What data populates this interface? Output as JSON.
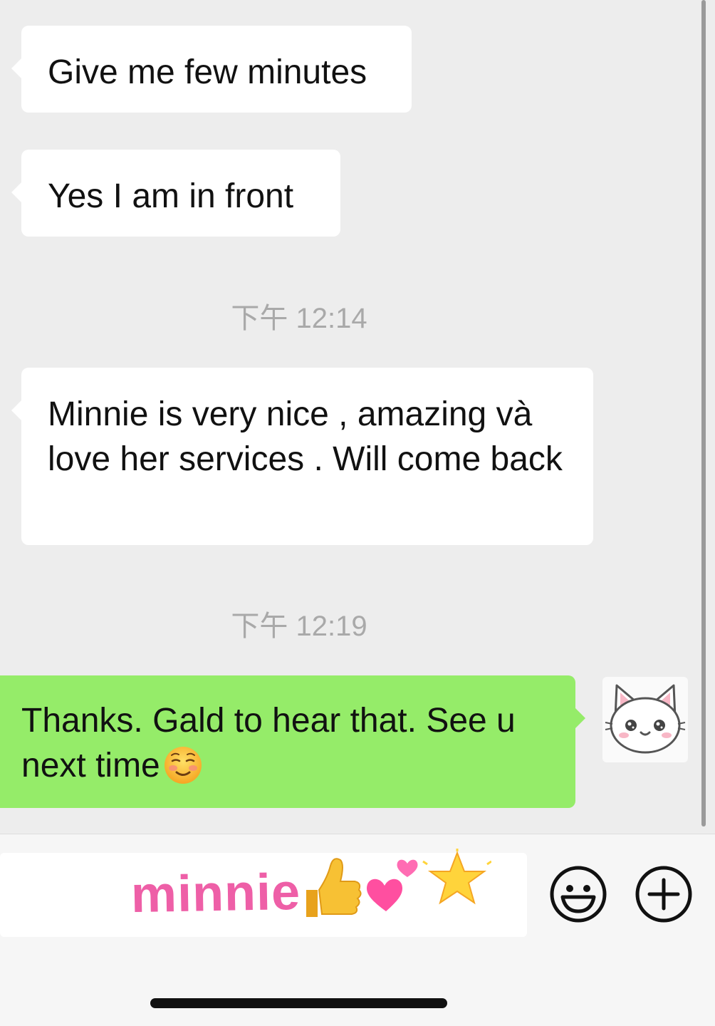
{
  "messages": [
    {
      "text": "Give me few minutes"
    },
    {
      "text": "Yes I am in front"
    },
    {
      "text": "Minnie is very nice , amazing và love her services . Will come back"
    },
    {
      "text": "Thanks. Gald to hear that. See u next time"
    }
  ],
  "timestamps": [
    "下午 12:14",
    "下午 12:19"
  ],
  "avatar": {
    "icon": "cat-icon"
  },
  "input": {
    "sticker_text": "minnie",
    "sticker_icons": [
      "thumbs-up-icon",
      "two-hearts-icon",
      "star-icon"
    ]
  },
  "toolbar": {
    "emoji_icon": "smiley-face-icon",
    "plus_icon": "plus-circle-icon"
  },
  "colors": {
    "background": "#ededed",
    "received_bubble": "#ffffff",
    "sent_bubble": "#95ec69",
    "timestamp": "#a9a9a9",
    "sticker_pink": "#ee5fa7"
  }
}
